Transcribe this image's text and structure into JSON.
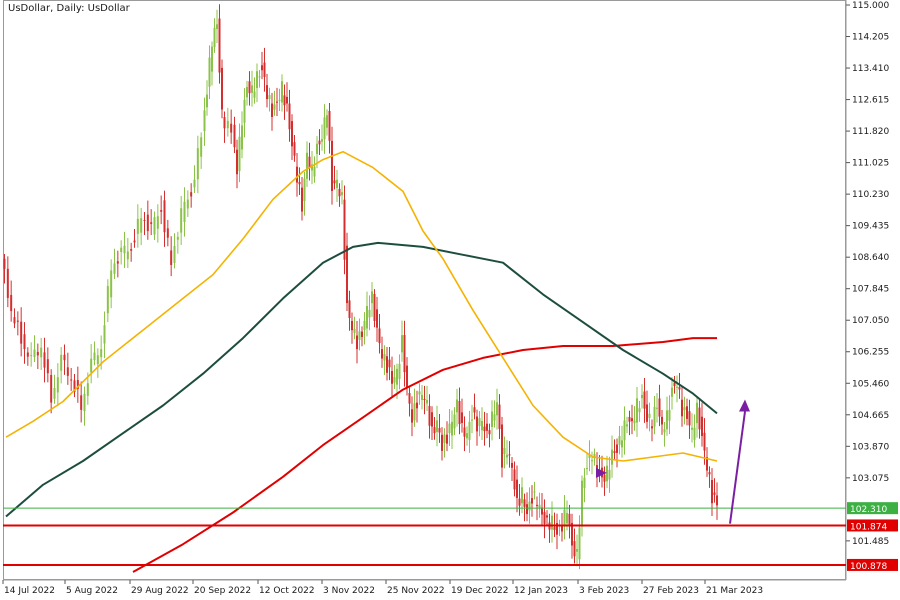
{
  "chart_data": {
    "type": "candlestick",
    "title": "UsDollar, Daily:  UsDollar",
    "y_axis": {
      "position": "right",
      "ylim": [
        100.7,
        115.0
      ],
      "ticks": [
        "115.000",
        "114.205",
        "113.410",
        "112.615",
        "111.820",
        "111.025",
        "110.230",
        "109.435",
        "108.640",
        "107.845",
        "107.050",
        "106.255",
        "105.460",
        "104.665",
        "103.870",
        "103.075"
      ]
    },
    "x_axis": {
      "tick_labels": [
        "14 Jul 2022",
        "5 Aug 2022",
        "29 Aug 2022",
        "20 Sep 2022",
        "12 Oct 2022",
        "3 Nov 2022",
        "25 Nov 2022",
        "19 Dec 2022",
        "12 Jan 2023",
        "3 Feb 2023",
        "27 Feb 2023",
        "21 Mar 2023"
      ]
    },
    "colors": {
      "up_candle": "#8bc34a",
      "down_candle": "#d32f2f",
      "ma_fast": "#f5b301",
      "ma_mid": "#1d4d3f",
      "ma_slow": "#e00000",
      "arrow": "#7b1fa2",
      "green_level": "#3cb043",
      "red_level": "#e00000"
    },
    "levels": [
      {
        "label": "102.310",
        "value": 102.31,
        "style": "green"
      },
      {
        "label": "101.874",
        "value": 101.874,
        "style": "red"
      },
      {
        "label": "101.485",
        "value": 101.485,
        "style": "tick"
      },
      {
        "label": "100.878",
        "value": 100.878,
        "style": "red"
      }
    ],
    "close_points": [
      {
        "x": 0,
        "y": 108.6
      },
      {
        "x": 10,
        "y": 107.3
      },
      {
        "x": 20,
        "y": 106.6
      },
      {
        "x": 30,
        "y": 106.0
      },
      {
        "x": 40,
        "y": 106.4
      },
      {
        "x": 50,
        "y": 105.1
      },
      {
        "x": 60,
        "y": 106.0
      },
      {
        "x": 70,
        "y": 105.6
      },
      {
        "x": 80,
        "y": 104.9
      },
      {
        "x": 90,
        "y": 105.9
      },
      {
        "x": 100,
        "y": 106.4
      },
      {
        "x": 110,
        "y": 108.4
      },
      {
        "x": 120,
        "y": 108.7
      },
      {
        "x": 130,
        "y": 108.9
      },
      {
        "x": 140,
        "y": 109.7
      },
      {
        "x": 150,
        "y": 109.3
      },
      {
        "x": 160,
        "y": 109.9
      },
      {
        "x": 170,
        "y": 108.5
      },
      {
        "x": 180,
        "y": 109.7
      },
      {
        "x": 190,
        "y": 110.3
      },
      {
        "x": 200,
        "y": 111.7
      },
      {
        "x": 205,
        "y": 112.9
      },
      {
        "x": 210,
        "y": 114.1
      },
      {
        "x": 215,
        "y": 114.5
      },
      {
        "x": 220,
        "y": 112.2
      },
      {
        "x": 230,
        "y": 111.8
      },
      {
        "x": 235,
        "y": 110.9
      },
      {
        "x": 240,
        "y": 112.1
      },
      {
        "x": 245,
        "y": 112.9
      },
      {
        "x": 250,
        "y": 112.8
      },
      {
        "x": 255,
        "y": 113.2
      },
      {
        "x": 260,
        "y": 113.4
      },
      {
        "x": 265,
        "y": 112.8
      },
      {
        "x": 270,
        "y": 112.3
      },
      {
        "x": 275,
        "y": 112.5
      },
      {
        "x": 280,
        "y": 112.9
      },
      {
        "x": 285,
        "y": 112.4
      },
      {
        "x": 290,
        "y": 111.5
      },
      {
        "x": 295,
        "y": 110.7
      },
      {
        "x": 300,
        "y": 109.9
      },
      {
        "x": 305,
        "y": 111.2
      },
      {
        "x": 310,
        "y": 110.8
      },
      {
        "x": 315,
        "y": 111.4
      },
      {
        "x": 320,
        "y": 111.7
      },
      {
        "x": 325,
        "y": 112.4
      },
      {
        "x": 330,
        "y": 110.4
      },
      {
        "x": 335,
        "y": 110.5
      },
      {
        "x": 340,
        "y": 110.1
      },
      {
        "x": 345,
        "y": 107.4
      },
      {
        "x": 350,
        "y": 106.9
      },
      {
        "x": 355,
        "y": 106.5
      },
      {
        "x": 360,
        "y": 106.7
      },
      {
        "x": 365,
        "y": 107.3
      },
      {
        "x": 370,
        "y": 107.6
      },
      {
        "x": 375,
        "y": 106.8
      },
      {
        "x": 380,
        "y": 106.2
      },
      {
        "x": 385,
        "y": 105.9
      },
      {
        "x": 390,
        "y": 105.5
      },
      {
        "x": 395,
        "y": 105.7
      },
      {
        "x": 400,
        "y": 106.5
      },
      {
        "x": 405,
        "y": 105.3
      },
      {
        "x": 410,
        "y": 104.6
      },
      {
        "x": 415,
        "y": 105.0
      },
      {
        "x": 420,
        "y": 105.2
      },
      {
        "x": 425,
        "y": 104.9
      },
      {
        "x": 430,
        "y": 104.2
      },
      {
        "x": 435,
        "y": 104.5
      },
      {
        "x": 440,
        "y": 103.9
      },
      {
        "x": 445,
        "y": 104.1
      },
      {
        "x": 450,
        "y": 104.5
      },
      {
        "x": 455,
        "y": 104.9
      },
      {
        "x": 460,
        "y": 104.3
      },
      {
        "x": 465,
        "y": 104.2
      },
      {
        "x": 470,
        "y": 104.7
      },
      {
        "x": 475,
        "y": 104.4
      },
      {
        "x": 480,
        "y": 104.5
      },
      {
        "x": 485,
        "y": 104.1
      },
      {
        "x": 490,
        "y": 104.6
      },
      {
        "x": 495,
        "y": 105.0
      },
      {
        "x": 500,
        "y": 103.5
      },
      {
        "x": 505,
        "y": 103.8
      },
      {
        "x": 510,
        "y": 103.3
      },
      {
        "x": 515,
        "y": 102.4
      },
      {
        "x": 520,
        "y": 102.7
      },
      {
        "x": 525,
        "y": 102.2
      },
      {
        "x": 530,
        "y": 102.6
      },
      {
        "x": 535,
        "y": 102.5
      },
      {
        "x": 540,
        "y": 102.1
      },
      {
        "x": 545,
        "y": 101.9
      },
      {
        "x": 550,
        "y": 102.0
      },
      {
        "x": 555,
        "y": 101.7
      },
      {
        "x": 560,
        "y": 101.9
      },
      {
        "x": 565,
        "y": 102.3
      },
      {
        "x": 570,
        "y": 101.3
      },
      {
        "x": 575,
        "y": 101.1
      },
      {
        "x": 580,
        "y": 102.9
      },
      {
        "x": 585,
        "y": 103.4
      },
      {
        "x": 590,
        "y": 103.7
      },
      {
        "x": 595,
        "y": 103.3
      },
      {
        "x": 600,
        "y": 103.0
      },
      {
        "x": 605,
        "y": 103.2
      },
      {
        "x": 610,
        "y": 103.7
      },
      {
        "x": 615,
        "y": 103.8
      },
      {
        "x": 620,
        "y": 104.2
      },
      {
        "x": 625,
        "y": 104.5
      },
      {
        "x": 630,
        "y": 104.4
      },
      {
        "x": 635,
        "y": 104.9
      },
      {
        "x": 640,
        "y": 105.1
      },
      {
        "x": 645,
        "y": 104.6
      },
      {
        "x": 650,
        "y": 104.5
      },
      {
        "x": 655,
        "y": 104.9
      },
      {
        "x": 660,
        "y": 104.3
      },
      {
        "x": 665,
        "y": 104.6
      },
      {
        "x": 670,
        "y": 105.3
      },
      {
        "x": 675,
        "y": 105.5
      },
      {
        "x": 680,
        "y": 104.8
      },
      {
        "x": 685,
        "y": 104.6
      },
      {
        "x": 690,
        "y": 104.2
      },
      {
        "x": 695,
        "y": 104.8
      },
      {
        "x": 700,
        "y": 104.1
      },
      {
        "x": 705,
        "y": 103.4
      },
      {
        "x": 710,
        "y": 102.6
      },
      {
        "x": 715,
        "y": 102.4
      }
    ],
    "ma_fast": [
      {
        "x": 3,
        "y": 104.1
      },
      {
        "x": 30,
        "y": 104.5
      },
      {
        "x": 60,
        "y": 105.0
      },
      {
        "x": 100,
        "y": 106.0
      },
      {
        "x": 140,
        "y": 106.8
      },
      {
        "x": 180,
        "y": 107.6
      },
      {
        "x": 210,
        "y": 108.2
      },
      {
        "x": 240,
        "y": 109.1
      },
      {
        "x": 270,
        "y": 110.1
      },
      {
        "x": 300,
        "y": 110.8
      },
      {
        "x": 320,
        "y": 111.1
      },
      {
        "x": 340,
        "y": 111.3
      },
      {
        "x": 370,
        "y": 110.9
      },
      {
        "x": 400,
        "y": 110.3
      },
      {
        "x": 420,
        "y": 109.3
      },
      {
        "x": 440,
        "y": 108.6
      },
      {
        "x": 470,
        "y": 107.3
      },
      {
        "x": 500,
        "y": 106.1
      },
      {
        "x": 530,
        "y": 104.9
      },
      {
        "x": 560,
        "y": 104.1
      },
      {
        "x": 590,
        "y": 103.6
      },
      {
        "x": 620,
        "y": 103.5
      },
      {
        "x": 650,
        "y": 103.6
      },
      {
        "x": 680,
        "y": 103.7
      },
      {
        "x": 714,
        "y": 103.5
      }
    ],
    "ma_mid": [
      {
        "x": 3,
        "y": 102.1
      },
      {
        "x": 40,
        "y": 102.9
      },
      {
        "x": 80,
        "y": 103.5
      },
      {
        "x": 120,
        "y": 104.2
      },
      {
        "x": 160,
        "y": 104.9
      },
      {
        "x": 200,
        "y": 105.7
      },
      {
        "x": 240,
        "y": 106.6
      },
      {
        "x": 280,
        "y": 107.6
      },
      {
        "x": 320,
        "y": 108.5
      },
      {
        "x": 350,
        "y": 108.9
      },
      {
        "x": 375,
        "y": 109.0
      },
      {
        "x": 420,
        "y": 108.9
      },
      {
        "x": 460,
        "y": 108.7
      },
      {
        "x": 500,
        "y": 108.5
      },
      {
        "x": 540,
        "y": 107.7
      },
      {
        "x": 580,
        "y": 107.0
      },
      {
        "x": 620,
        "y": 106.3
      },
      {
        "x": 660,
        "y": 105.7
      },
      {
        "x": 690,
        "y": 105.2
      },
      {
        "x": 714,
        "y": 104.7
      }
    ],
    "ma_slow": [
      {
        "x": 130,
        "y": 100.7
      },
      {
        "x": 180,
        "y": 101.4
      },
      {
        "x": 230,
        "y": 102.2
      },
      {
        "x": 280,
        "y": 103.1
      },
      {
        "x": 320,
        "y": 103.9
      },
      {
        "x": 360,
        "y": 104.6
      },
      {
        "x": 400,
        "y": 105.3
      },
      {
        "x": 440,
        "y": 105.8
      },
      {
        "x": 480,
        "y": 106.1
      },
      {
        "x": 520,
        "y": 106.3
      },
      {
        "x": 560,
        "y": 106.4
      },
      {
        "x": 610,
        "y": 106.4
      },
      {
        "x": 660,
        "y": 106.5
      },
      {
        "x": 690,
        "y": 106.6
      },
      {
        "x": 714,
        "y": 106.6
      }
    ],
    "arrows": [
      {
        "x1": 727,
        "y1": 101.92,
        "x2": 742,
        "y2": 105.0,
        "kind": "line-arrow"
      },
      {
        "x": 596,
        "y": 103.2,
        "kind": "triangle-marker"
      }
    ]
  }
}
